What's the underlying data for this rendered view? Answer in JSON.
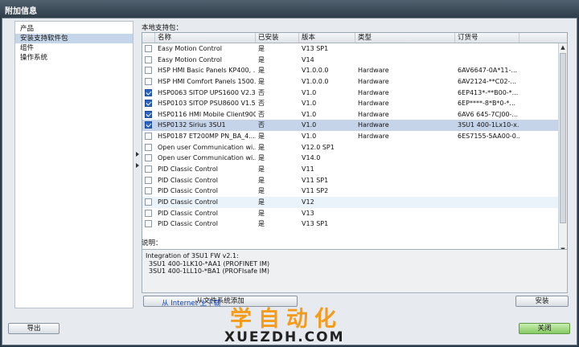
{
  "window": {
    "title": "附加信息"
  },
  "sidebar": {
    "items": [
      {
        "label": "产品",
        "selected": false
      },
      {
        "label": "安装支持软件包",
        "selected": true
      },
      {
        "label": "组件",
        "selected": false
      },
      {
        "label": "操作系统",
        "selected": false
      }
    ]
  },
  "packages": {
    "section_label": "本地支持包：",
    "columns": [
      "名称",
      "已安装",
      "版本",
      "类型",
      "订货号"
    ],
    "rows": [
      {
        "checked": false,
        "name": "Easy Motion Control",
        "installed": "是",
        "version": "V13 SP1",
        "type": "",
        "order": ""
      },
      {
        "checked": false,
        "name": "Easy Motion Control",
        "installed": "是",
        "version": "V14",
        "type": "",
        "order": ""
      },
      {
        "checked": false,
        "name": "HSP HMI Basic Panels KP400, ...",
        "installed": "是",
        "version": "V1.0.0.0",
        "type": "Hardware",
        "order": "6AV6647-0A*11-..."
      },
      {
        "checked": false,
        "name": "HSP HMI Comfort Panels 1500...",
        "installed": "是",
        "version": "V1.0.0.0",
        "type": "Hardware",
        "order": "6AV2124-**C02-..."
      },
      {
        "checked": true,
        "name": "HSP0063 SITOP UPS1600 V2.3",
        "installed": "否",
        "version": "V1.0",
        "type": "Hardware",
        "order": "6EP413*-**B00-*..."
      },
      {
        "checked": true,
        "name": "HSP0103 SITOP PSU8600 V1.5",
        "installed": "否",
        "version": "V1.0",
        "type": "Hardware",
        "order": "6EP****-8*B*0-*..."
      },
      {
        "checked": true,
        "name": "HSP0116 HMI Mobile Client900",
        "installed": "否",
        "version": "V1.0",
        "type": "Hardware",
        "order": "6AV6 645-7CJ00-..."
      },
      {
        "checked": true,
        "name": "HSP0132 Sirius 3SU1",
        "installed": "否",
        "version": "V1.0",
        "type": "Hardware",
        "order": "3SU1 400-1Lx10-x...",
        "selected": true
      },
      {
        "checked": false,
        "name": "HSP0187 ET200MP PN_BA_4....",
        "installed": "是",
        "version": "V1.0",
        "type": "Hardware",
        "order": "6ES7155-5AA00-0..."
      },
      {
        "checked": false,
        "name": "Open user Communication wi...",
        "installed": "是",
        "version": "V12.0 SP1",
        "type": "",
        "order": ""
      },
      {
        "checked": false,
        "name": "Open user Communication wi...",
        "installed": "是",
        "version": "V14.0",
        "type": "",
        "order": ""
      },
      {
        "checked": false,
        "name": "PID Classic Control",
        "installed": "是",
        "version": "V11",
        "type": "",
        "order": ""
      },
      {
        "checked": false,
        "name": "PID Classic Control",
        "installed": "是",
        "version": "V11 SP1",
        "type": "",
        "order": ""
      },
      {
        "checked": false,
        "name": "PID Classic Control",
        "installed": "是",
        "version": "V11 SP2",
        "type": "",
        "order": ""
      },
      {
        "checked": false,
        "name": "PID Classic Control",
        "installed": "是",
        "version": "V12",
        "type": "",
        "order": "",
        "hover": true
      },
      {
        "checked": false,
        "name": "PID Classic Control",
        "installed": "是",
        "version": "V13",
        "type": "",
        "order": ""
      },
      {
        "checked": false,
        "name": "PID Classic Control",
        "installed": "是",
        "version": "V13 SP1",
        "type": "",
        "order": ""
      }
    ]
  },
  "description": {
    "label": "说明：",
    "lines": [
      "Integration of 3SU1 FW v2.1:",
      "3SU1 400-1LK10-*AA1 (PROFINET IM)",
      "3SU1 400-1LL10-*BA1 (PROFIsafe IM)"
    ]
  },
  "actions": {
    "add_from_fs": "从文件系统添加",
    "download_link": "从 Internet 上下载",
    "install": "安装",
    "export": "导出",
    "close": "关闭"
  },
  "watermark": {
    "cn": "学自动化",
    "en": "XUEZDH.COM"
  }
}
